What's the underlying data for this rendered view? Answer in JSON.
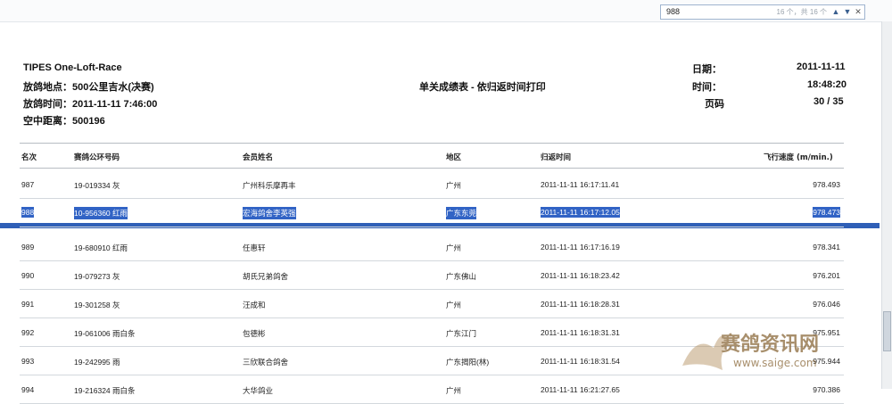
{
  "find": {
    "query": "988",
    "count": "16 个，共 16 个",
    "up_icon": "arrow-up-icon",
    "down_icon": "arrow-down-icon",
    "close_icon": "close-icon"
  },
  "report": {
    "org": "TIPES One-Loft-Race",
    "release_place": "放鸽地点：500公里吉水(决赛)",
    "release_time": "放鸽时间：2011-11-11 7:46:00",
    "distance": "空中距离：500196",
    "title": "单关成绩表 - 依归返时间打印",
    "date_label": "日期：",
    "date_value": "2011-11-11",
    "time_label": "时间：",
    "time_value": "18:48:20",
    "page_label": "页码",
    "page_value": "30 / 35"
  },
  "table": {
    "headers": [
      "名次",
      "赛鸽公环号码",
      "会员姓名",
      "地区",
      "归返时间",
      "飞行速度 (m/min.)"
    ],
    "rows": [
      {
        "rank": "987",
        "ring": "19-019334 灰",
        "name": "广州科乐摩再丰",
        "area": "广州",
        "time": "2011-11-11 16:17:11.41",
        "speed": "978.493",
        "selected": false
      },
      {
        "rank": "988",
        "ring": "10-956360 红雨",
        "name": "宏海鸽舍李英强",
        "area": "广东东莞",
        "time": "2011-11-11 16:17:12.05",
        "speed": "978.473",
        "selected": true
      },
      {
        "rank": "989",
        "ring": "19-680910 红雨",
        "name": "任惠轩",
        "area": "广州",
        "time": "2011-11-11 16:17:16.19",
        "speed": "978.341",
        "selected": false
      },
      {
        "rank": "990",
        "ring": "19-079273 灰",
        "name": "胡氏兄弟鸽舍",
        "area": "广东佛山",
        "time": "2011-11-11 16:18:23.42",
        "speed": "976.201",
        "selected": false
      },
      {
        "rank": "991",
        "ring": "19-301258 灰",
        "name": "汪成和",
        "area": "广州",
        "time": "2011-11-11 16:18:28.31",
        "speed": "976.046",
        "selected": false
      },
      {
        "rank": "992",
        "ring": "19-061006 雨白条",
        "name": "包德彬",
        "area": "广东江门",
        "time": "2011-11-11 16:18:31.31",
        "speed": "975.951",
        "selected": false
      },
      {
        "rank": "993",
        "ring": "19-242995 雨",
        "name": "三欣联合鸽舍",
        "area": "广东揭阳(林)",
        "time": "2011-11-11 16:18:31.54",
        "speed": "975.944",
        "selected": false
      },
      {
        "rank": "994",
        "ring": "19-216324 雨白条",
        "name": "大华鸽业",
        "area": "广州",
        "time": "2011-11-11 16:21:27.65",
        "speed": "970.386",
        "selected": false
      }
    ]
  },
  "watermark": {
    "name": "赛鸽资讯网",
    "url": "www.saige.com"
  }
}
